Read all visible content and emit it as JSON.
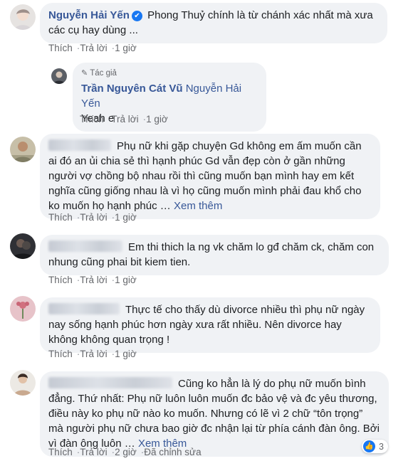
{
  "comments": [
    {
      "author": "Nguyễn Hải Yến",
      "text": "Phong Thuỷ chính là từ chánh xác nhất mà xưa các cụ hay dùng ...",
      "like_label": "Thích",
      "reply_label": "Trả lời",
      "time": "1 giờ"
    },
    {
      "author_badge": "Tác giả",
      "author": "Trần Nguyên Cát Vũ",
      "mention": "Nguyễn Hải Yến",
      "text": "Yeah e",
      "like_label": "Thích",
      "reply_label": "Trả lời",
      "time": "1 giờ"
    },
    {
      "text": "Phụ nữ khi gặp chuyện Gd không em ấm muốn cần ai đó an ủi chia sẻ thì hạnh phúc Gd vẫn đẹp còn ở gần những người vợ chồng bộ nhau rồi thì cũng muốn bạn mình hay em kết nghĩa cũng giống nhau là vì họ cũng muốn mình phải đau khổ cho ko muốn họ hạnh phúc …",
      "see_more": "Xem thêm",
      "like_label": "Thích",
      "reply_label": "Trả lời",
      "time": "1 giờ"
    },
    {
      "text": "Em thi thich la ng vk chăm lo gđ chăm ck, chăm con nhung cũng phai bit kiem tien.",
      "like_label": "Thích",
      "reply_label": "Trả lời",
      "time": "1 giờ"
    },
    {
      "text": "Thực tế cho thấy dù divorce nhiều thì phụ nữ ngày nay sống hạnh phúc hơn ngày xưa rất nhiều. Nên divorce hay không không quan trọng !",
      "like_label": "Thích",
      "reply_label": "Trả lời",
      "time": "1 giờ"
    },
    {
      "text": "Cũng ko hẳn là lý do phụ nữ muốn bình đẳng. Thứ nhất: Phụ nữ luôn luôn muốn đc bảo vệ và đc yêu thương, điều này ko phụ nữ nào ko muốn. Nhưng có lẽ vì 2 chữ “tôn trọng” mà người phụ nữ chưa bao giờ đc nhận lại từ phía cánh đàn ông. Bởi vì đàn ông luôn …",
      "see_more": "Xem thêm",
      "like_label": "Thích",
      "reply_label": "Trả lời",
      "time": "2 giờ",
      "edited_label": "Đã chỉnh sửa",
      "reaction_count": "3"
    }
  ]
}
